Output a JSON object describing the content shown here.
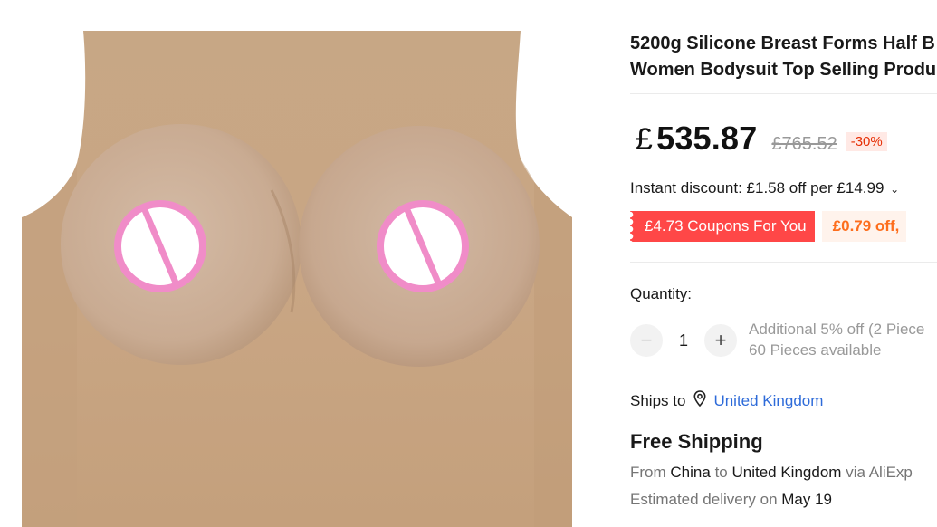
{
  "product": {
    "title_line1": "5200g Silicone Breast Forms Half B",
    "title_line2": "Women Bodysuit Top Selling Produ",
    "image_alt": "product-image"
  },
  "price": {
    "currency": "£",
    "current": "535.87",
    "original": "£765.52",
    "discount": "-30%"
  },
  "instant_discount": {
    "label": "Instant discount:",
    "text": "£1.58 off per £14.99"
  },
  "coupons": {
    "primary": "£4.73 Coupons For You",
    "secondary": "£0.79 off,"
  },
  "quantity": {
    "label": "Quantity:",
    "value": "1",
    "minus": "−",
    "plus": "+",
    "additional": "Additional 5% off (2 Piece",
    "available": "60 Pieces available"
  },
  "shipping": {
    "ships_to_label": "Ships to",
    "country": "United Kingdom",
    "free_shipping": "Free Shipping",
    "from_label": "From",
    "from_country": "China",
    "to_label": "to",
    "to_country": "United Kingdom",
    "via": "via AliExp",
    "eta_label": "Estimated delivery on",
    "eta_date": "May 19"
  },
  "colors": {
    "accent_red": "#ff4747",
    "orange": "#fd6e1d",
    "link_blue": "#2e6bd9",
    "skin": "#c9a888",
    "censor_pink": "#f08cc8"
  },
  "icons": {
    "pin": "location-pin-icon",
    "chevron": "chevron-down-icon"
  }
}
